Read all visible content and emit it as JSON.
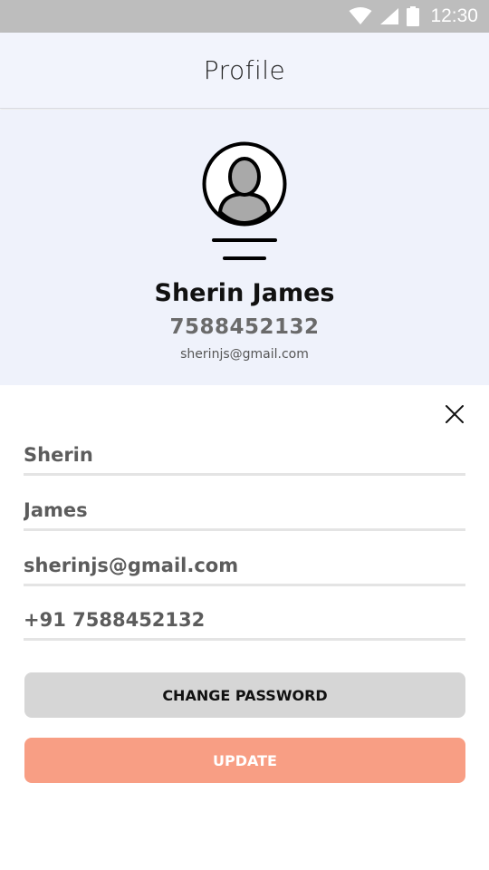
{
  "status_bar": {
    "time": "12:30",
    "icons": [
      "wifi-icon",
      "signal-icon",
      "battery-icon"
    ]
  },
  "header": {
    "title": "Profile"
  },
  "profile": {
    "name": "Sherin James",
    "phone": "7588452132",
    "email": "sherinjs@gmail.com",
    "avatar_icon": "user-avatar-icon"
  },
  "form": {
    "close_icon": "close-icon",
    "first_name": "Sherin",
    "last_name": "James",
    "email": "sherinjs@gmail.com",
    "phone": "+91 7588452132",
    "change_password_label": "CHANGE PASSWORD",
    "update_label": "UPDATE"
  },
  "colors": {
    "status_bar": "#bdbdbd",
    "header_bg": "#f2f4fc",
    "card_bg": "#eff2fb",
    "change_password_bg": "#d6d6d6",
    "update_bg": "#f89e84"
  }
}
